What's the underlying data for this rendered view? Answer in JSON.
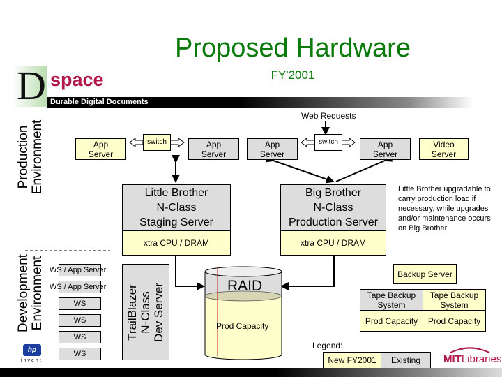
{
  "header": {
    "title": "Proposed Hardware",
    "subtitle": "FY'2001"
  },
  "logo": {
    "letter": "D",
    "word": "space",
    "tagline": "Durable Digital Documents"
  },
  "sections": {
    "production": [
      "Production",
      "Environment"
    ],
    "development": [
      "Development",
      "Environment"
    ]
  },
  "production": {
    "web_requests": "Web Requests",
    "app_server_1": [
      "App",
      "Server"
    ],
    "switch_1": "switch",
    "app_server_2": [
      "App",
      "Server"
    ],
    "app_server_3": [
      "App",
      "Server"
    ],
    "switch_2": "switch",
    "app_server_4": [
      "App",
      "Server"
    ],
    "video_server": [
      "Video",
      "Server"
    ],
    "little_brother": [
      "Little Brother",
      "N-Class",
      "Staging Server"
    ],
    "little_brother_ext": "xtra CPU / DRAM",
    "big_brother": [
      "Big Brother",
      "N-Class",
      "Production Server"
    ],
    "big_brother_ext": "xtra CPU / DRAM",
    "note": "Little Brother upgradable to carry production load if necessary, while upgrades and/or maintenance occurs on Big Brother"
  },
  "development": {
    "workstations": [
      "WS / App Server",
      "WS / App Server",
      "WS",
      "WS",
      "WS",
      "WS"
    ],
    "trailblazer": [
      "TrailBlazer",
      "N-Class",
      "Dev Server"
    ]
  },
  "storage": {
    "raid": "RAID",
    "raid_capacity": "Prod Capacity",
    "backup_server": "Backup Server",
    "tape_1": [
      "Tape Backup",
      "System"
    ],
    "tape_1_capacity": "Prod Capacity",
    "tape_2": [
      "Tape Backup",
      "System"
    ],
    "tape_2_capacity": "Prod Capacity"
  },
  "legend": {
    "label": "Legend:",
    "new": "New FY2001",
    "existing": "Existing"
  },
  "footer": {
    "hp": "hp",
    "hp_tagline": "invent",
    "mit_bold": "MIT",
    "mit_rest": "Libraries"
  },
  "colors": {
    "title": "#0a7a0a",
    "new": "#ffffcc",
    "existing": "#dddddd",
    "brand": "#b01848"
  }
}
